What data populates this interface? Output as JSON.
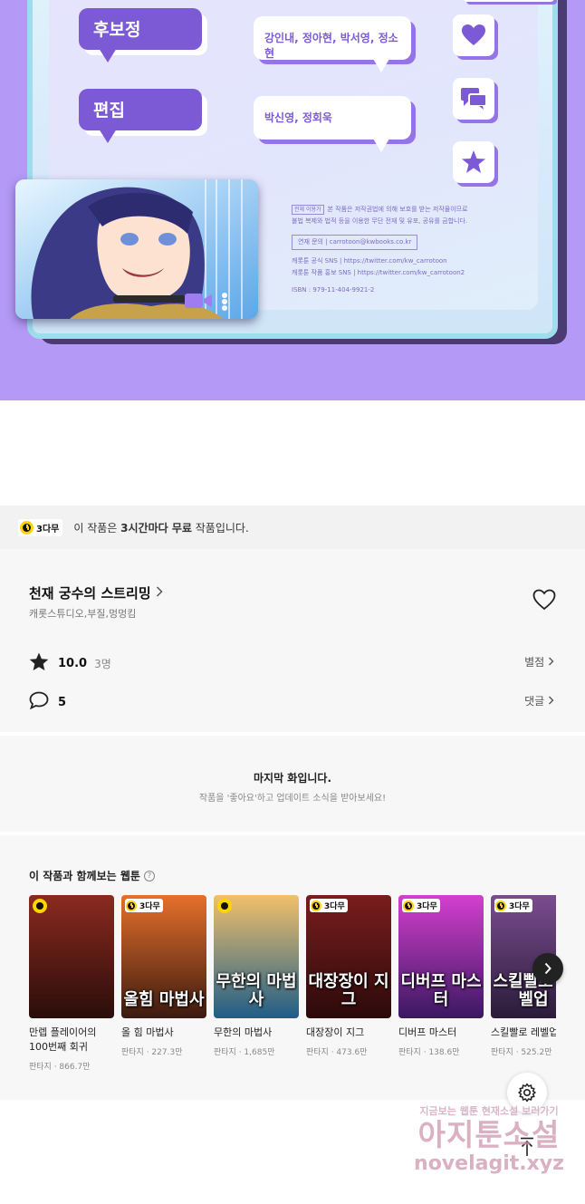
{
  "credits": {
    "roles": [
      {
        "label": "후보정",
        "names": "강인내, 정아현, 박서영, 정소현"
      },
      {
        "label": "편집",
        "names": "박신영, 정회욱"
      }
    ],
    "legal": {
      "rating": "전체 이용가",
      "line1": "본 작품은 저작권법에 의해 보호를 받는 저작물이므로",
      "line2": "불법 복제와 법적 등을 이용한 무단 전재 및 유포, 공유를 금합니다.",
      "contact": "연재 문의 | carrotoon@kwbooks.co.kr",
      "sns1": "캐롯툰 공식 SNS | https://twitter.com/kw_carrotoon",
      "sns2": "캐롯툰 작품 홍보 SNS | https://twitter.com/kw_carrotoon2",
      "isbn": "ISBN : 979-11-404-9921-2"
    },
    "side_icons": [
      "heart-icon",
      "chat-icon",
      "star-icon"
    ]
  },
  "notice": {
    "badge": "3다무",
    "prefix": "이 작품은 ",
    "bold": "3시간마다 무료",
    "suffix": " 작품입니다."
  },
  "work": {
    "title": "천재 궁수의 스트리밍",
    "authors": "캐롯스튜디오,부질,멍멍킴",
    "rating": "10.0",
    "rating_count": "3명",
    "rating_link": "별점",
    "comments": "5",
    "comments_link": "댓글"
  },
  "last_episode": {
    "title": "마지막 화입니다.",
    "subtitle": "작품을 '좋아요'하고 업데이트 소식을 받아보세요!"
  },
  "recommendations": {
    "title": "이 작품과 함께보는 웹툰",
    "items": [
      {
        "title": "만렙 플레이어의 100번째 회귀",
        "meta": "판타지 · 866.7만",
        "badge": "",
        "cover_text": "",
        "color_top": "#8b2a1f",
        "color_bottom": "#2a0d0a"
      },
      {
        "title": "올 힘 마법사",
        "meta": "판타지 · 227.3만",
        "badge": "3다무",
        "cover_text": "올힘 마법사",
        "color_top": "#e6702b",
        "color_bottom": "#3b1a10"
      },
      {
        "title": "무한의 마법사",
        "meta": "판타지 · 1,685만",
        "badge": "",
        "cover_text": "무한의 마법사",
        "color_top": "#f2c06a",
        "color_bottom": "#1f5d87"
      },
      {
        "title": "대장장이 지그",
        "meta": "판타지 · 473.6만",
        "badge": "3다무",
        "cover_text": "대장장이 지그",
        "color_top": "#7a1d1d",
        "color_bottom": "#2c0a0a"
      },
      {
        "title": "디버프 마스터",
        "meta": "판타지 · 138.6만",
        "badge": "3다무",
        "cover_text": "디버프 마스터",
        "color_top": "#d43fd0",
        "color_bottom": "#3a1860"
      },
      {
        "title": "스킬빨로 레벨업",
        "meta": "판타지 · 525.2만",
        "badge": "3다무",
        "cover_text": "스킬빨로 레벨업",
        "color_top": "#7a4d8f",
        "color_bottom": "#2b1b3a"
      }
    ]
  },
  "watermark": {
    "line1": "지금보는 웹툰 현재소설 보러가기",
    "line2": "아지툰소설",
    "line3": "novelagit.xyz"
  },
  "colors": {
    "purple": "#7c5ad6",
    "lavender_bg": "#b49af6",
    "badge_yellow": "#ffd400"
  }
}
